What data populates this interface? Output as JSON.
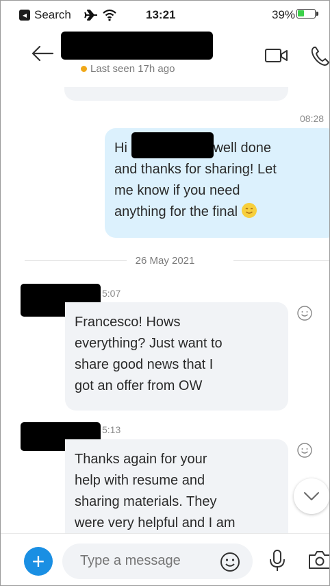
{
  "status_bar": {
    "back_app": "Search",
    "time": "13:21",
    "battery_pct": "39%",
    "battery_level": 0.39,
    "battery_color": "#3bd14a",
    "icons": [
      "back-app-icon",
      "airplane-icon",
      "wifi-icon",
      "battery-icon"
    ]
  },
  "header": {
    "last_seen": "Last seen 17h ago",
    "presence_color": "#f0a818",
    "icons": [
      "back-arrow-icon",
      "video-call-icon",
      "phone-icon"
    ]
  },
  "messages": [
    {
      "direction": "outgoing",
      "time": "08:28",
      "line1_prefix": "Hi",
      "line1_suffix": "well done",
      "rest": "and thanks for sharing! Let\nme know if you need\nanything for the final",
      "emoji": "wink-smile"
    },
    {
      "direction": "incoming",
      "time": "5:07",
      "text": "Francesco! Hows\neverything? Just want to\nshare good news that I\ngot an offer from OW"
    },
    {
      "direction": "incoming",
      "time": "5:13",
      "text": "Thanks again for your\nhelp with resume and\nsharing materials. They\nwere very helpful and I am"
    }
  ],
  "date_divider": "26 May 2021",
  "composer": {
    "placeholder": "Type a message",
    "accent_color": "#1a8fe3"
  },
  "colors": {
    "outgoing_bubble": "#dcf1fd",
    "incoming_bubble": "#f1f3f6"
  }
}
